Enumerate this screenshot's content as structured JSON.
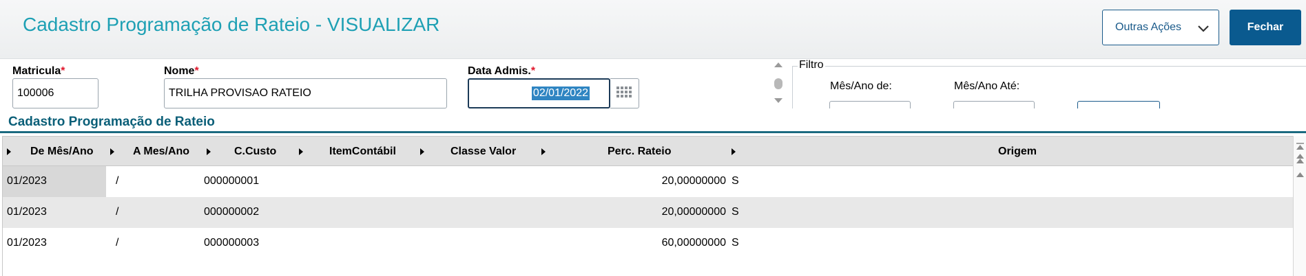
{
  "header": {
    "title": "Cadastro Programação de Rateio - VISUALIZAR",
    "outras_acoes_label": "Outras Ações",
    "fechar_label": "Fechar"
  },
  "form": {
    "matricula": {
      "label": "Matricula",
      "value": "100006"
    },
    "nome": {
      "label": "Nome",
      "value": "TRILHA PROVISAO RATEIO"
    },
    "data_admis": {
      "label": "Data Admis.",
      "value": "02/01/2022"
    },
    "required_mark": "*"
  },
  "filtro": {
    "legend": "Filtro",
    "mes_ano_de_label": "Mês/Ano de:",
    "mes_ano_ate_label": "Mês/Ano Até:"
  },
  "section": {
    "title": "Cadastro Programação de Rateio"
  },
  "grid": {
    "columns": [
      "De Mês/Ano",
      "A Mes/Ano",
      "C.Custo",
      "ItemContábil",
      "Classe Valor",
      "Perc. Rateio",
      "Origem"
    ],
    "rows": [
      {
        "de": "01/2023",
        "a": "/",
        "ccusto": "000000001",
        "item": "",
        "classe": "",
        "perc": "20,00000000",
        "origem": "S"
      },
      {
        "de": "01/2023",
        "a": "/",
        "ccusto": "000000002",
        "item": "",
        "classe": "",
        "perc": "20,00000000",
        "origem": "S"
      },
      {
        "de": "01/2023",
        "a": "/",
        "ccusto": "000000003",
        "item": "",
        "classe": "",
        "perc": "60,00000000",
        "origem": "S"
      }
    ]
  },
  "colors": {
    "title": "#1ea0b4",
    "primary_button": "#0a5a8f",
    "required": "#e0162b",
    "section_title": "#0b5f78",
    "selection": "#2f85c2"
  }
}
